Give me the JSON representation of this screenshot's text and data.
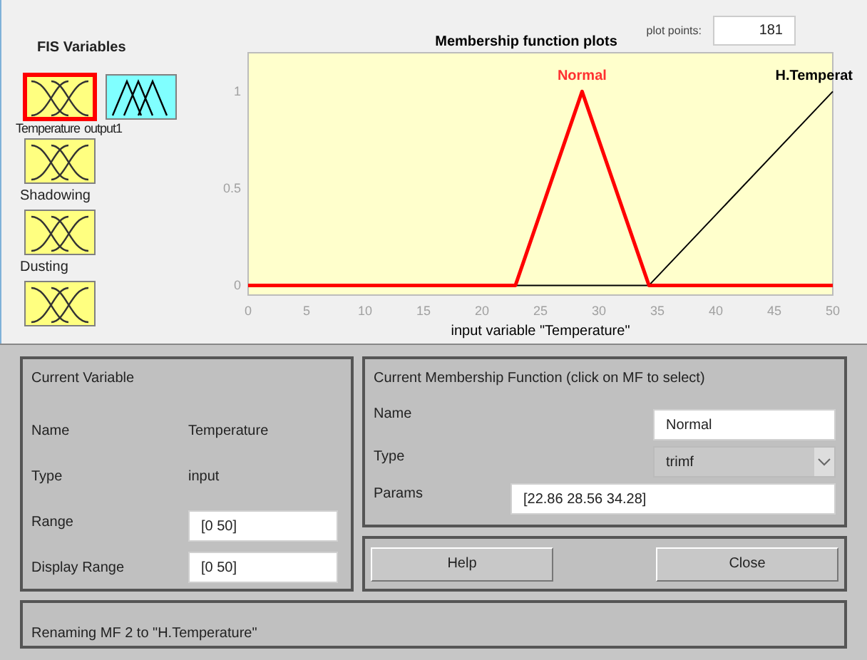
{
  "fis_variables": {
    "title": "FIS Variables",
    "items": [
      {
        "name": "Temperature",
        "kind": "input",
        "selected": true
      },
      {
        "name": "output1",
        "kind": "output",
        "selected": false
      },
      {
        "name": "Shadowing",
        "kind": "input",
        "selected": false
      },
      {
        "name": "Dusting",
        "kind": "input",
        "selected": false
      },
      {
        "kind": "input",
        "selected": false
      }
    ]
  },
  "plot": {
    "plot_points_label": "plot points:",
    "plot_points": "181",
    "chart_data": {
      "type": "line",
      "title": "Membership function plots",
      "xlabel": "input variable \"Temperature\"",
      "x": [
        0,
        22.86,
        28.56,
        34.28,
        50
      ],
      "series": [
        {
          "name": "H.Temperat",
          "color": "#000000",
          "values": [
            0,
            0,
            0,
            0,
            1
          ]
        },
        {
          "name": "Normal",
          "color": "#ff0000",
          "values": [
            0,
            0,
            1,
            0,
            0
          ]
        }
      ],
      "xlim": [
        0,
        50
      ],
      "ylim": [
        -0.05,
        1.2
      ],
      "xticks": [
        0,
        5,
        10,
        15,
        20,
        25,
        30,
        35,
        40,
        45,
        50
      ],
      "yticks": [
        0,
        {
          "value": 0.5,
          "label": "0.5"
        },
        1
      ]
    }
  },
  "current_variable": {
    "title": "Current Variable",
    "name_label": "Name",
    "name": "Temperature",
    "type_label": "Type",
    "type": "input",
    "range_label": "Range",
    "range": "[0 50]",
    "display_range_label": "Display Range",
    "display_range": "[0 50]"
  },
  "current_mf": {
    "title": "Current Membership Function (click on MF to select)",
    "name_label": "Name",
    "name": "Normal",
    "type_label": "Type",
    "type": "trimf",
    "params_label": "Params",
    "params": "[22.86 28.56 34.28]"
  },
  "buttons": [
    "Help",
    "Close"
  ],
  "status_bar": "Renaming MF 2 to \"H.Temperature\""
}
